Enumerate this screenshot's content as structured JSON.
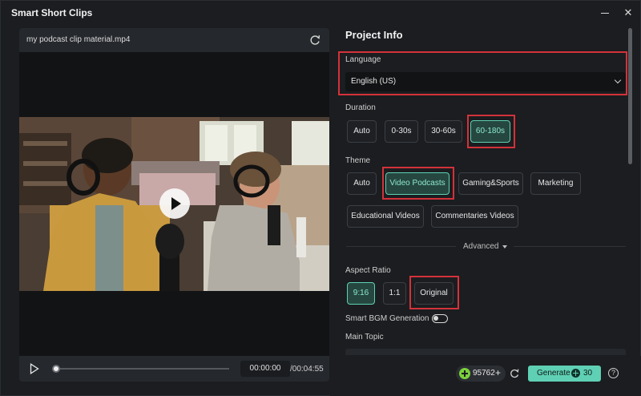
{
  "window": {
    "title": "Smart Short Clips",
    "minimize_label": "",
    "close_label": "✕"
  },
  "preview": {
    "file_name": "my podcast clip material.mp4",
    "time_current": "00:00:00",
    "time_total": "/00:04:55",
    "progress": 0.0
  },
  "project": {
    "title": "Project Info",
    "language": {
      "label": "Language",
      "value": "English (US)"
    },
    "duration": {
      "label": "Duration",
      "options": [
        "Auto",
        "0-30s",
        "30-60s",
        "60-180s"
      ],
      "selected": "60-180s"
    },
    "theme": {
      "label": "Theme",
      "options": [
        "Auto",
        "Video Podcasts",
        "Gaming&Sports",
        "Marketing",
        "Educational Videos",
        "Commentaries Videos"
      ],
      "selected": "Video Podcasts"
    },
    "advanced_label": "Advanced",
    "aspect_ratio": {
      "label": "Aspect Ratio",
      "options": [
        "9:16",
        "1:1",
        "Original"
      ],
      "selected": "9:16"
    },
    "bgm": {
      "label": "Smart BGM Generation",
      "enabled": false
    },
    "main_topic": {
      "label": "Main Topic"
    }
  },
  "footer": {
    "credits": "95762",
    "credits_plus": "+",
    "generate_label": "Generate",
    "generate_cost": "30",
    "help": "?"
  },
  "colors": {
    "accent": "#5fd0b4",
    "highlight": "#d3323a",
    "background": "#1b1d20"
  }
}
